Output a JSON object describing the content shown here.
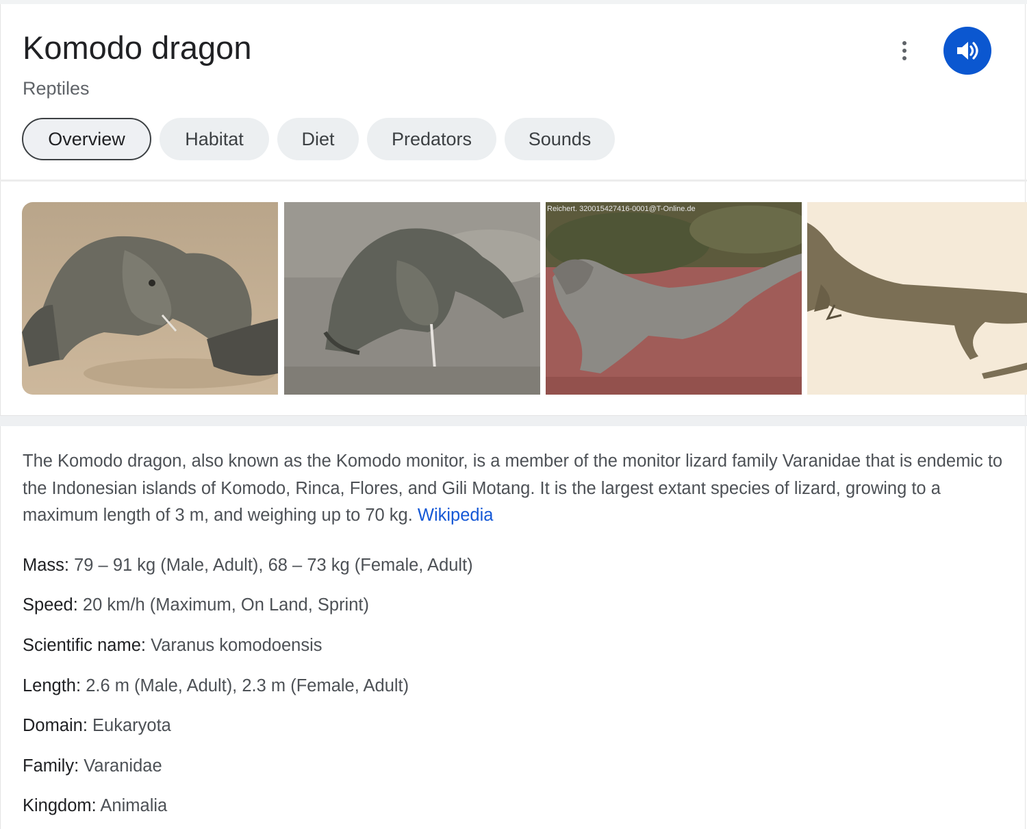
{
  "header": {
    "title": "Komodo dragon",
    "subtitle": "Reptiles",
    "more_icon": "more-vert-icon",
    "speaker_icon": "volume-up-icon",
    "accent_color": "#0b57d0"
  },
  "tabs": [
    {
      "label": "Overview",
      "selected": true
    },
    {
      "label": "Habitat",
      "selected": false
    },
    {
      "label": "Diet",
      "selected": false
    },
    {
      "label": "Predators",
      "selected": false
    },
    {
      "label": "Sounds",
      "selected": false
    }
  ],
  "gallery": {
    "photo3_watermark": "Reichert. 320015427416-0001@T-Online.de"
  },
  "description": {
    "text": "The Komodo dragon, also known as the Komodo monitor, is a member of the monitor lizard family Varanidae that is endemic to the Indonesian islands of Komodo, Rinca, Flores, and Gili Motang. It is the largest extant species of lizard, growing to a maximum length of 3 m, and weighing up to 70 kg. ",
    "source_link": "Wikipedia"
  },
  "facts": [
    {
      "key": "Mass:",
      "value": "79 – 91 kg (Male, Adult), 68 – 73 kg (Female, Adult)"
    },
    {
      "key": "Speed:",
      "value": "20 km/h (Maximum, On Land, Sprint)"
    },
    {
      "key": "Scientific name:",
      "value": "Varanus komodoensis"
    },
    {
      "key": "Length:",
      "value": "2.6 m (Male, Adult), 2.3 m (Female, Adult)"
    },
    {
      "key": "Domain:",
      "value": "Eukaryota"
    },
    {
      "key": "Family:",
      "value": "Varanidae"
    },
    {
      "key": "Kingdom:",
      "value": "Animalia"
    }
  ]
}
